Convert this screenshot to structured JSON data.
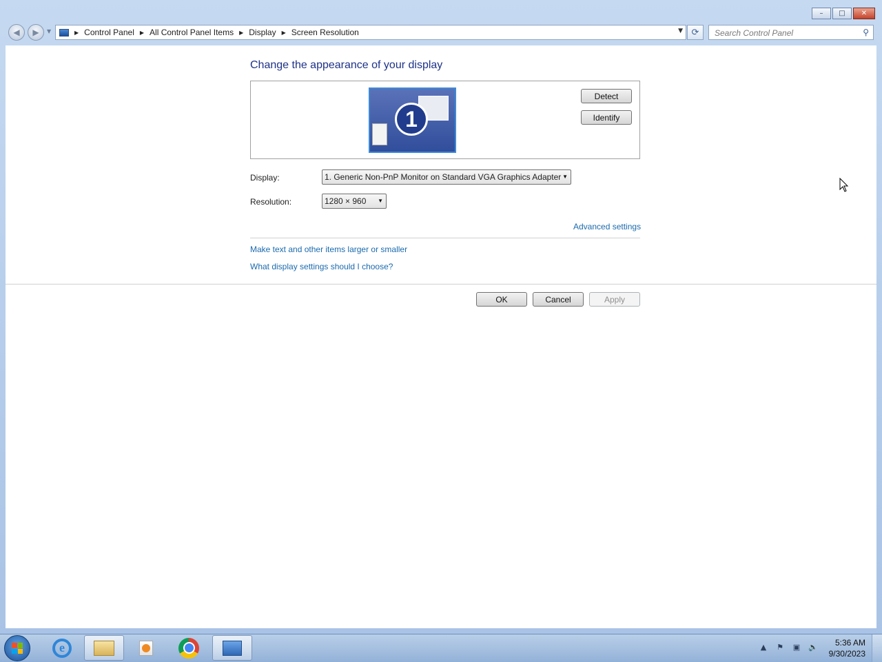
{
  "window": {
    "caption": {
      "minimize": "–",
      "maximize": "□",
      "close": "✕"
    }
  },
  "navbar": {
    "back": "◀",
    "forward": "▶",
    "breadcrumb": [
      "Control Panel",
      "All Control Panel Items",
      "Display",
      "Screen Resolution"
    ],
    "search_placeholder": "Search Control Panel"
  },
  "main": {
    "title": "Change the appearance of your display",
    "monitor_number": "1",
    "detect_label": "Detect",
    "identify_label": "Identify",
    "display_label": "Display:",
    "display_value": "1. Generic Non-PnP Monitor on Standard VGA Graphics Adapter",
    "resolution_label": "Resolution:",
    "resolution_value": "1280 × 960",
    "advanced_link": "Advanced settings",
    "links": [
      "Make text and other items larger or smaller",
      "What display settings should I choose?"
    ],
    "ok_label": "OK",
    "cancel_label": "Cancel",
    "apply_label": "Apply"
  },
  "taskbar": {
    "items": [
      "start-button",
      "internet-explorer",
      "windows-explorer",
      "media-player",
      "chrome",
      "screen-resolution-window"
    ],
    "clock_time": "5:36 AM",
    "clock_date": "9/30/2023"
  },
  "colors": {
    "accent": "#1e3287",
    "link": "#1a6aad",
    "frame": "#a9c3e6"
  }
}
